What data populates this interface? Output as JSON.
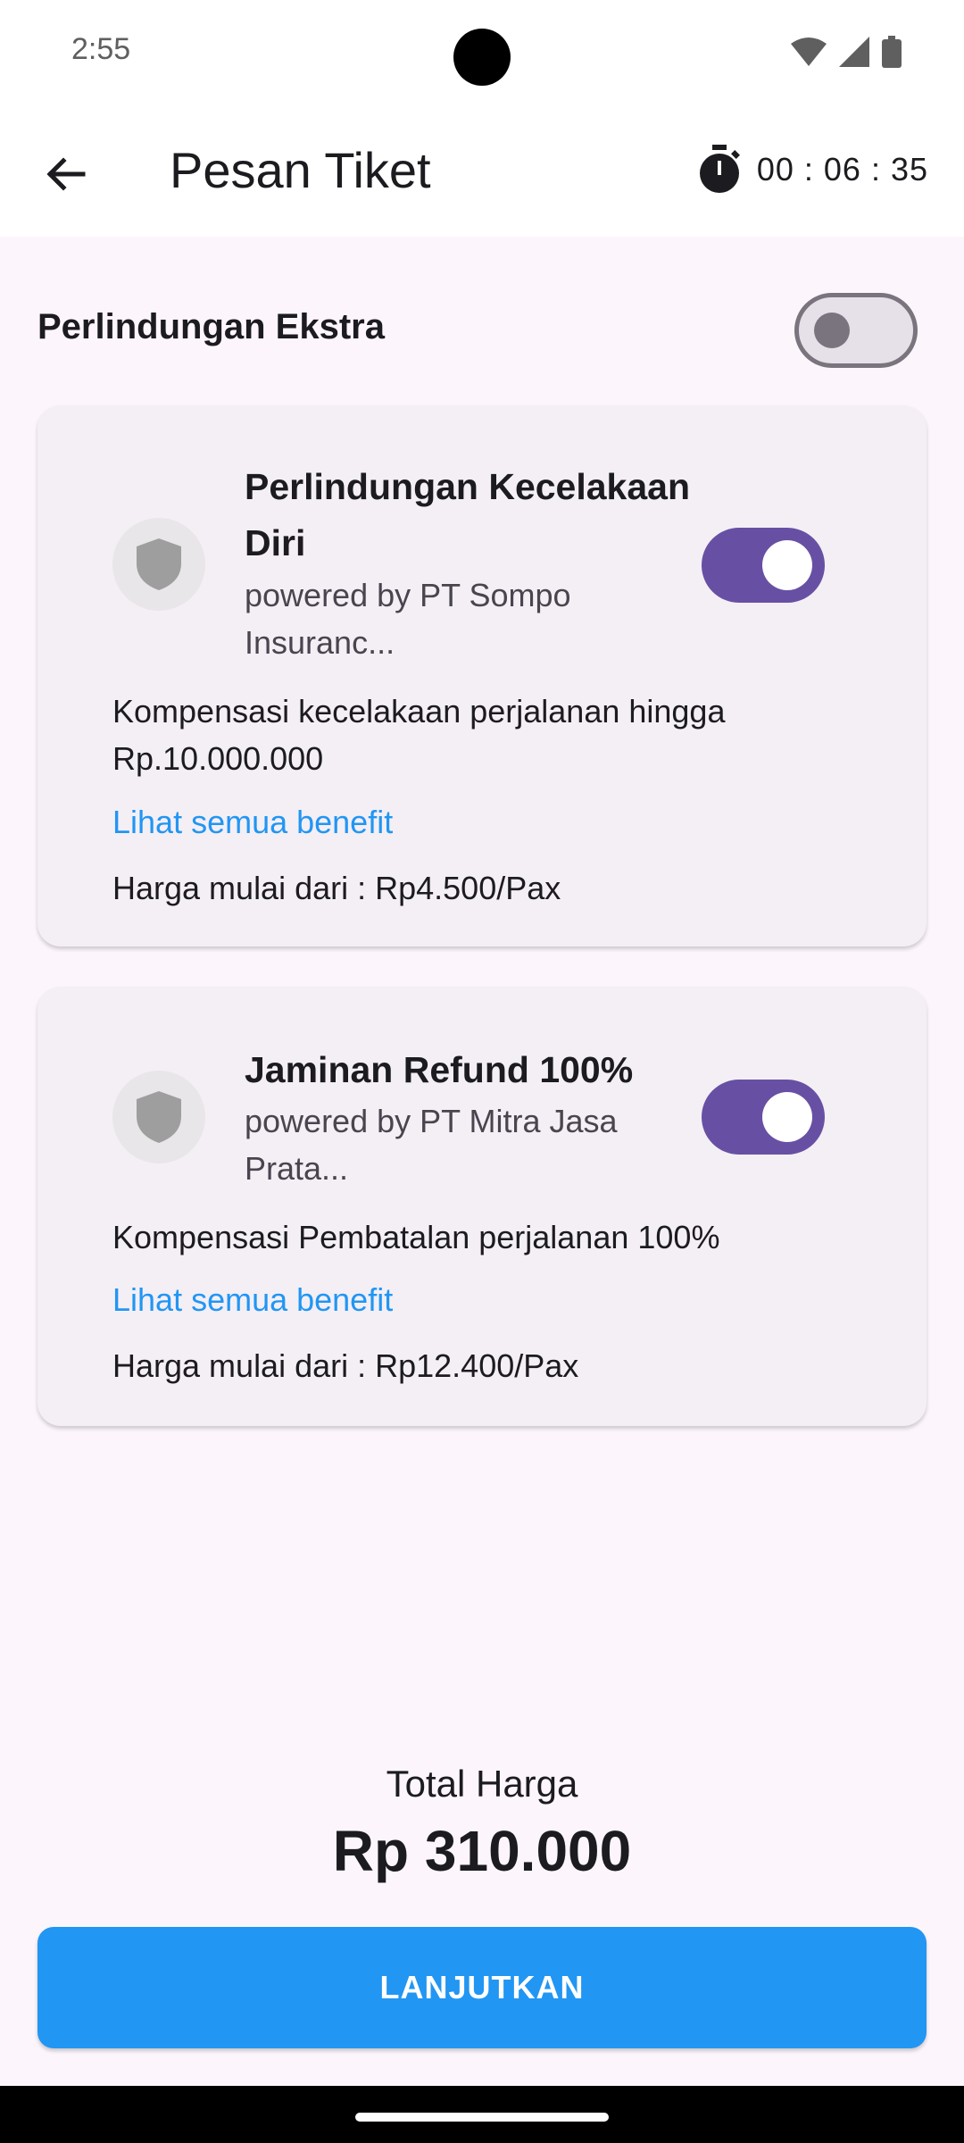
{
  "status_bar": {
    "time": "2:55",
    "icons": [
      "wifi-icon",
      "signal-icon",
      "battery-icon"
    ]
  },
  "app_bar": {
    "title": "Pesan Tiket",
    "timer": "00 : 06 : 35"
  },
  "extra_protection": {
    "title": "Perlindungan Ekstra",
    "enabled": false
  },
  "products": [
    {
      "title": "Perlindungan Kecelakaan Diri",
      "provider": "powered by PT Sompo Insuranc...",
      "description": "Kompensasi kecelakaan perjalanan hingga Rp.10.000.000",
      "link": "Lihat semua benefit",
      "price": "Harga mulai dari : Rp4.500/Pax",
      "enabled": true
    },
    {
      "title": "Jaminan Refund 100%",
      "provider": "powered by PT Mitra Jasa Prata...",
      "description": "Kompensasi Pembatalan perjalanan 100%",
      "link": "Lihat semua benefit",
      "price": "Harga mulai dari : Rp12.400/Pax",
      "enabled": true
    }
  ],
  "total": {
    "label": "Total Harga",
    "value": "Rp 310.000"
  },
  "cta": {
    "label": "LANJUTKAN"
  },
  "colors": {
    "primary": "#2196f3",
    "switch_on": "#6750a4",
    "background": "#fcf6fc",
    "card": "#f4eff5"
  }
}
